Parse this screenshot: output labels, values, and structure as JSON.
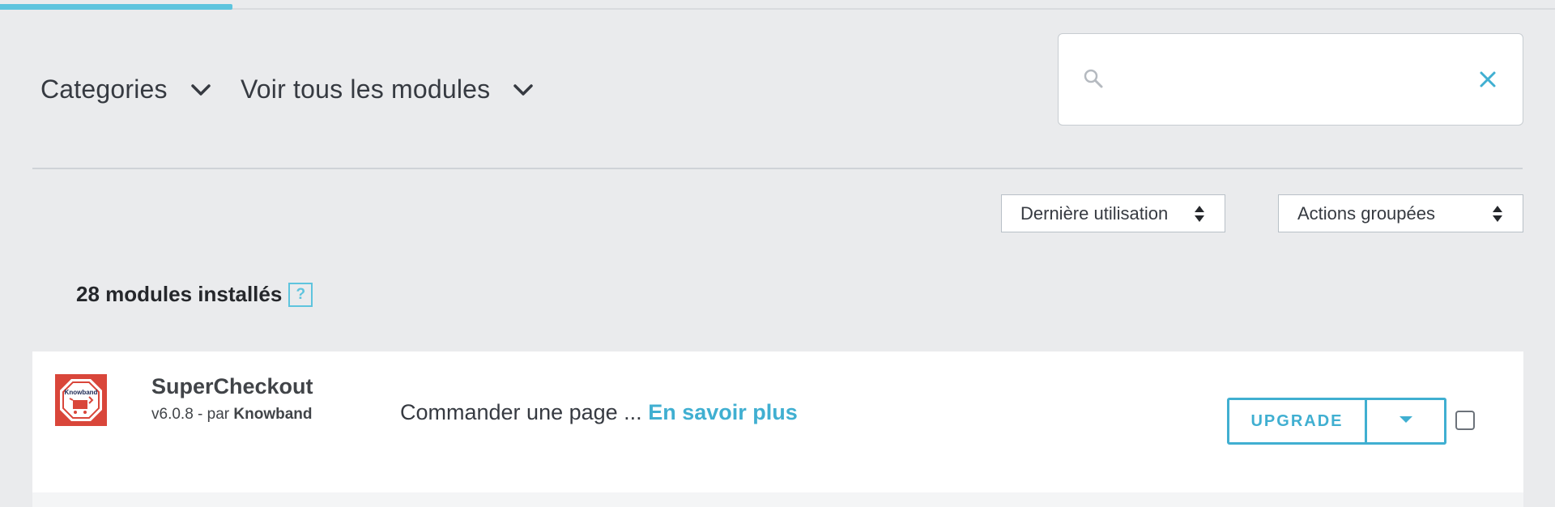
{
  "filters": {
    "categories_label": "Categories",
    "all_modules_label": "Voir tous les modules"
  },
  "search": {
    "value": "",
    "placeholder": ""
  },
  "sort": {
    "selected": "Dernière utilisation"
  },
  "bulk_actions": {
    "selected": "Actions groupées"
  },
  "count": {
    "text": "28 modules installés",
    "help_symbol": "?"
  },
  "modules": [
    {
      "name": "SuperCheckout",
      "version_prefix": "v6.0.8 - par ",
      "author": "Knowband",
      "description": "Commander une page ...",
      "more_link": "En savoir plus",
      "action_label": "UPGRADE",
      "logo_text": "Knowband",
      "selected": false
    }
  ],
  "colors": {
    "accent": "#5ec4de",
    "link": "#40afd1",
    "background": "#eaebed",
    "logo_red": "#d9463a"
  },
  "icons": {
    "search": "search-icon",
    "clear": "close-icon",
    "chevron": "chevron-down-icon",
    "sort_arrows": "sort-arrows-icon",
    "caret": "caret-down-icon"
  }
}
